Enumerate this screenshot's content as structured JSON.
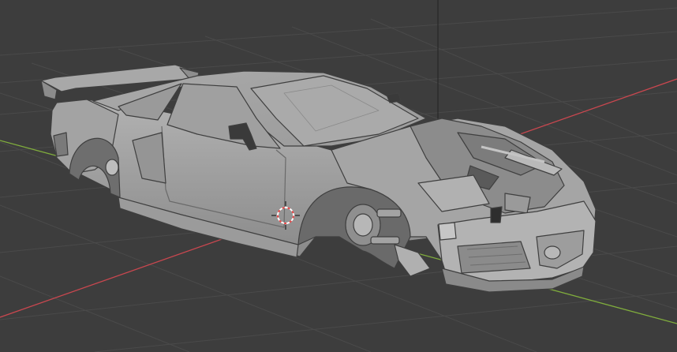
{
  "app": {
    "window_title": "",
    "view": "3D Viewport",
    "shading": "solid"
  },
  "viewport": {
    "background_color": "#3d3d3d",
    "grid_line_color": "#4a4a4a",
    "x_axis_color": "#c8474f",
    "y_axis_color": "#80ad3d",
    "z_axis_color": "#2c2c2c",
    "grid_visible": true
  },
  "scene": {
    "object": "car-body-mesh",
    "object_color": "#9f9f9f",
    "has_3d_cursor": true
  }
}
